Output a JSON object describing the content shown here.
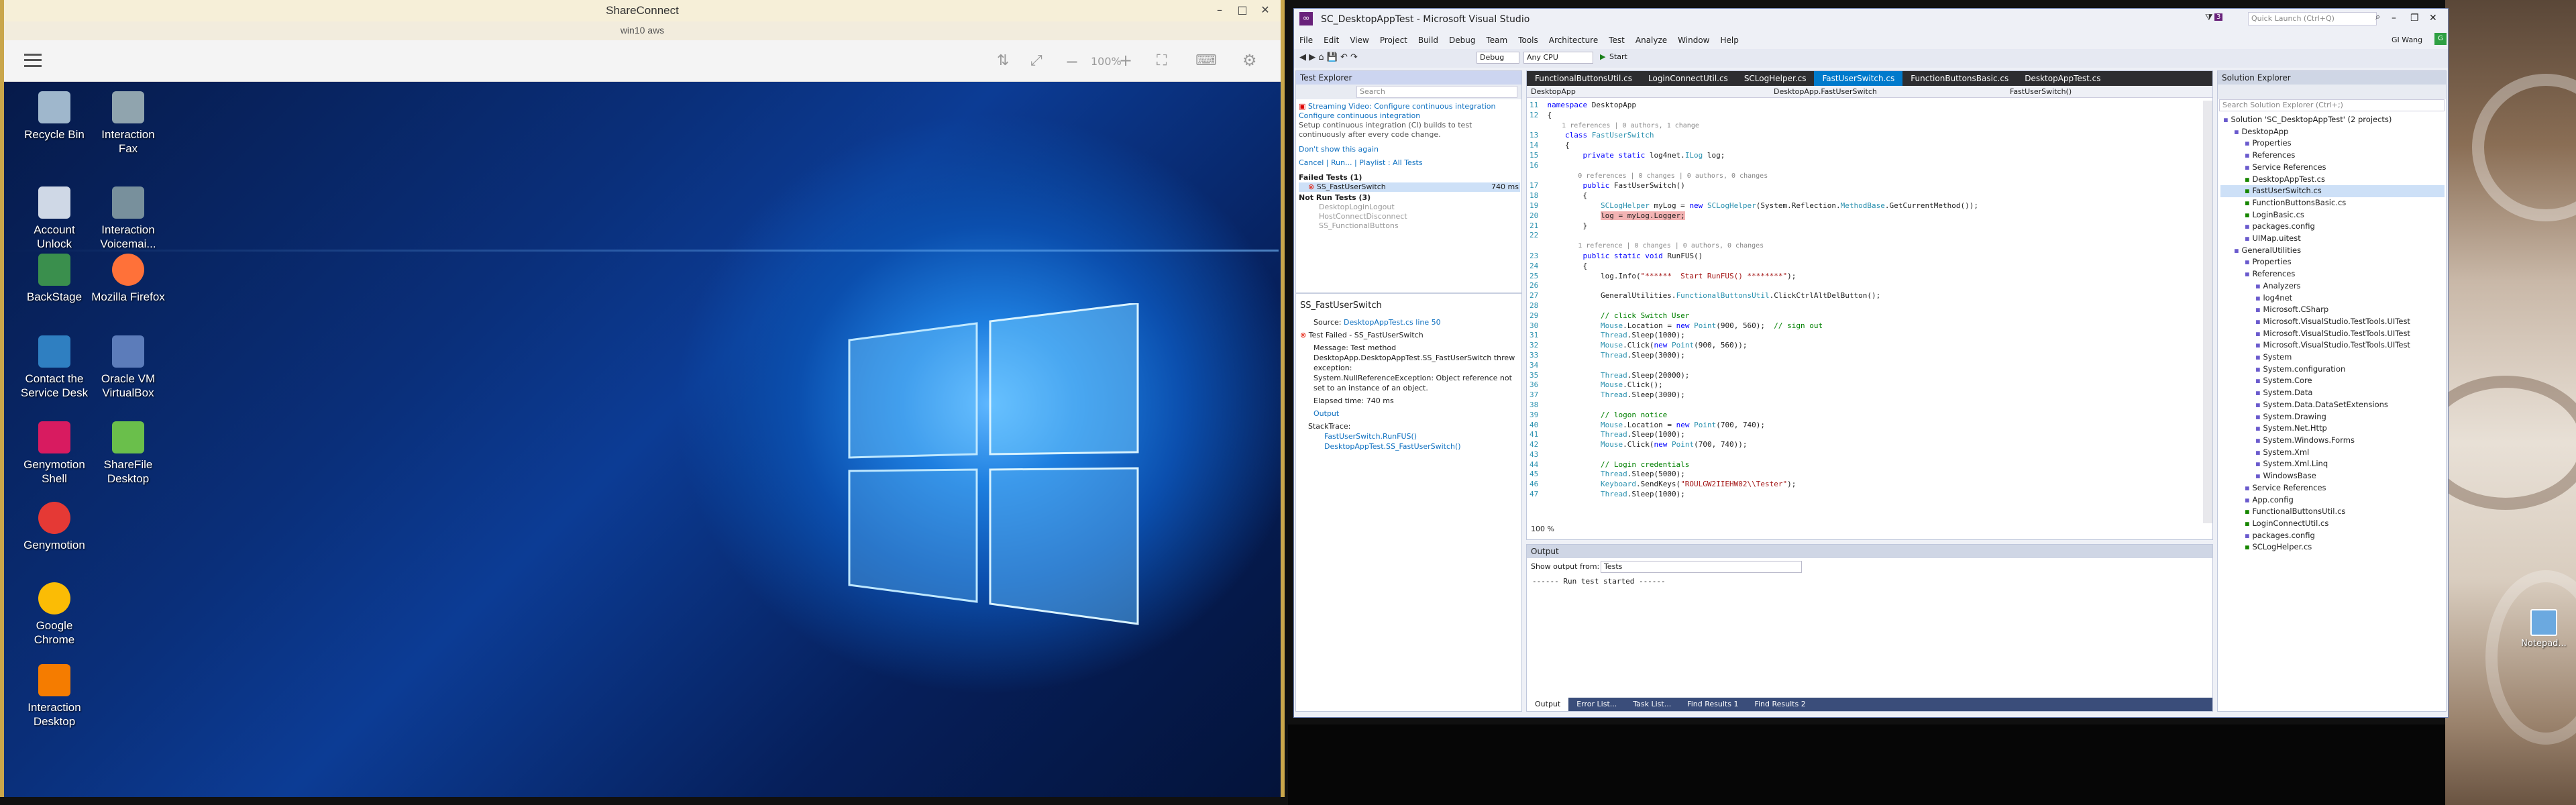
{
  "sharec": {
    "title": "ShareConnect",
    "subtitle": "win10 aws",
    "zoom": "100%",
    "desktop_icons": [
      {
        "label": "Recycle Bin",
        "icon": "recycle-bin-icon"
      },
      {
        "label": "Account Unlock",
        "icon": "account-unlock-icon"
      },
      {
        "label": "BackStage",
        "icon": "backstage-icon"
      },
      {
        "label": "Contact the Service Desk",
        "icon": "service-desk-icon"
      },
      {
        "label": "Genymotion Shell",
        "icon": "genymotion-shell-icon"
      },
      {
        "label": "Genymotion",
        "icon": "genymotion-icon"
      },
      {
        "label": "Google Chrome",
        "icon": "chrome-icon"
      },
      {
        "label": "Interaction Desktop",
        "icon": "interaction-desktop-icon"
      },
      {
        "label": "Interaction Fax",
        "icon": "interaction-fax-icon"
      },
      {
        "label": "Interaction Voicemai...",
        "icon": "voicemail-icon"
      },
      {
        "label": "Mozilla Firefox",
        "icon": "firefox-icon"
      },
      {
        "label": "Oracle VM VirtualBox",
        "icon": "virtualbox-icon"
      },
      {
        "label": "ShareFile Desktop",
        "icon": "sharefile-icon"
      }
    ]
  },
  "vs": {
    "title": "SC_DesktopAppTest - Microsoft Visual Studio",
    "quick_launch": "Quick Launch (Ctrl+Q)",
    "user": "GI Wang",
    "notif": "3",
    "menu": [
      "File",
      "Edit",
      "View",
      "Project",
      "Build",
      "Debug",
      "Team",
      "Tools",
      "Architecture",
      "Test",
      "Analyze",
      "Window",
      "Help"
    ],
    "toolbar": {
      "config": "Debug",
      "platform": "Any CPU",
      "start": "Start"
    },
    "tabs": [
      "FunctionalButtonsUtil.cs",
      "LoginConnectUtil.cs",
      "SCLogHelper.cs",
      "FastUserSwitch.cs",
      "FunctionButtonsBasic.cs",
      "DesktopAppTest.cs"
    ],
    "nav": [
      "DesktopApp",
      "DesktopApp.FastUserSwitch",
      "FastUserSwitch()"
    ],
    "editor_zoom": "100 %",
    "test_explorer": {
      "title": "Test Explorer",
      "search": "Search",
      "banner_link": "Streaming Video: Configure continuous integration",
      "banner_link2": "Configure continuous integration",
      "banner_text": "Setup continuous integration (CI) builds to test continuously after every code change.",
      "banner_dismiss": "Don't show this again",
      "cancel": "Cancel",
      "run": "Run...",
      "playlist": "Playlist : All Tests",
      "failed_hdr": "Failed Tests (1)",
      "failed_test": "SS_FastUserSwitch",
      "failed_time": "740 ms",
      "notrun_hdr": "Not Run Tests (3)",
      "notrun": [
        "DesktopLoginLogout",
        "HostConnectDisconnect",
        "SS_FunctionalButtons"
      ],
      "detail_title": "SS_FastUserSwitch",
      "source_label": "Source:",
      "source_link": "DesktopAppTest.cs line 50",
      "result": "Test Failed - SS_FastUserSwitch",
      "message": "Message: Test method DesktopApp.DesktopAppTest.SS_FastUserSwitch threw exception:",
      "exception": "System.NullReferenceException: Object reference not set to an instance of an object.",
      "elapsed": "Elapsed time: 740 ms",
      "output": "Output",
      "stack_hdr": "StackTrace:",
      "stack": [
        "FastUserSwitch.RunFUS()",
        "DesktopAppTest.SS_FastUserSwitch()"
      ]
    },
    "output": {
      "title": "Output",
      "show_label": "Show output from:",
      "source": "Tests",
      "text": "------ Run test started ------",
      "bottom_tabs": [
        "Output",
        "Error List...",
        "Task List...",
        "Find Results 1",
        "Find Results 2"
      ]
    },
    "solution": {
      "title": "Solution Explorer",
      "search": "Search Solution Explorer (Ctrl+;)",
      "items": [
        {
          "t": "Solution 'SC_DesktopAppTest' (2 projects)",
          "d": 0
        },
        {
          "t": "DesktopApp",
          "d": 1
        },
        {
          "t": "Properties",
          "d": 2
        },
        {
          "t": "References",
          "d": 2
        },
        {
          "t": "Service References",
          "d": 2
        },
        {
          "t": "DesktopAppTest.cs",
          "d": 2
        },
        {
          "t": "FastUserSwitch.cs",
          "d": 2
        },
        {
          "t": "FunctionButtonsBasic.cs",
          "d": 2
        },
        {
          "t": "LoginBasic.cs",
          "d": 2
        },
        {
          "t": "packages.config",
          "d": 2
        },
        {
          "t": "UIMap.uitest",
          "d": 2
        },
        {
          "t": "GeneralUtilities",
          "d": 1
        },
        {
          "t": "Properties",
          "d": 2
        },
        {
          "t": "References",
          "d": 2
        },
        {
          "t": "Analyzers",
          "d": 3
        },
        {
          "t": "log4net",
          "d": 3
        },
        {
          "t": "Microsoft.CSharp",
          "d": 3
        },
        {
          "t": "Microsoft.VisualStudio.TestTools.UITest",
          "d": 3
        },
        {
          "t": "Microsoft.VisualStudio.TestTools.UITest",
          "d": 3
        },
        {
          "t": "Microsoft.VisualStudio.TestTools.UITest",
          "d": 3
        },
        {
          "t": "System",
          "d": 3
        },
        {
          "t": "System.configuration",
          "d": 3
        },
        {
          "t": "System.Core",
          "d": 3
        },
        {
          "t": "System.Data",
          "d": 3
        },
        {
          "t": "System.Data.DataSetExtensions",
          "d": 3
        },
        {
          "t": "System.Drawing",
          "d": 3
        },
        {
          "t": "System.Net.Http",
          "d": 3
        },
        {
          "t": "System.Windows.Forms",
          "d": 3
        },
        {
          "t": "System.Xml",
          "d": 3
        },
        {
          "t": "System.Xml.Linq",
          "d": 3
        },
        {
          "t": "WindowsBase",
          "d": 3
        },
        {
          "t": "Service References",
          "d": 2
        },
        {
          "t": "App.config",
          "d": 2
        },
        {
          "t": "FunctionalButtonsUtil.cs",
          "d": 2
        },
        {
          "t": "LoginConnectUtil.cs",
          "d": 2
        },
        {
          "t": "packages.config",
          "d": 2
        },
        {
          "t": "SCLogHelper.cs",
          "d": 2
        }
      ]
    }
  },
  "desktop_right": {
    "label": "Notepad..."
  }
}
